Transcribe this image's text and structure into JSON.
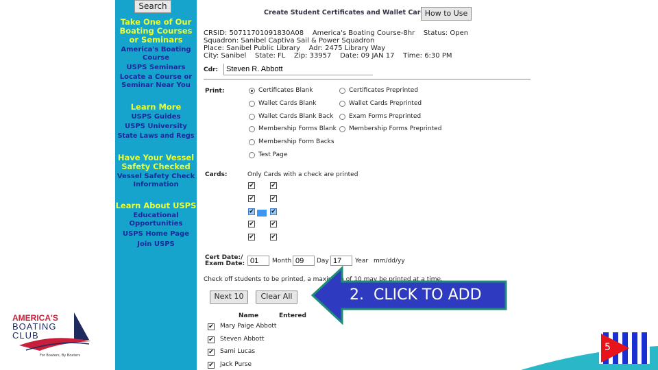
{
  "sidebar": {
    "search_label": "Search",
    "sections": [
      {
        "heading": "Take One of Our Boating Courses or Seminars",
        "links": [
          "America's Boating Course",
          "USPS Seminars",
          "Locate a Course or Seminar Near You"
        ]
      },
      {
        "heading": "Learn More",
        "links": [
          "USPS Guides",
          "USPS University",
          "State Laws and Regs"
        ]
      },
      {
        "heading": "Have Your Vessel Safety Checked",
        "links": [
          "Vessel Safety Check Information"
        ]
      },
      {
        "heading": "Learn About USPS",
        "links": [
          "Educational Opportunities",
          "USPS Home Page",
          "Join USPS"
        ]
      }
    ]
  },
  "header": {
    "title": "Create Student Certificates and Wallet Cards",
    "how_to_use": "How to Use"
  },
  "course": {
    "line1": "CRSID: 50711701091830A08    America's Boating Course-8hr    Status: Open",
    "line2": "Squadron: Sanibel Captiva Sail & Power Squadron",
    "line3": "Place: Sanibel Public Library    Adr: 2475 Library Way",
    "line4": "City: Sanibel    State: FL    Zip: 33957    Date: 09 JAN 17    Time: 6:30 PM"
  },
  "cdr": {
    "label": "Cdr:",
    "value": "Steven R. Abbott"
  },
  "print": {
    "label": "Print:",
    "options": [
      "Certificates Blank",
      "Wallet Cards Blank",
      "Wallet Cards Blank Back",
      "Membership Forms Blank",
      "Membership Form Backs",
      "Test Page",
      "Certificates Preprinted",
      "Wallet Cards Preprinted",
      "Exam Forms Preprinted",
      "Membership Forms Preprinted"
    ],
    "selected": "Certificates Blank"
  },
  "cards": {
    "label": "Cards:",
    "note": "Only Cards with a check are printed"
  },
  "dates": {
    "label1": "Cert Date:/",
    "label2": "Exam Date:",
    "month": "01",
    "month_label": "Month",
    "day": "09",
    "day_label": "Day",
    "year": "17",
    "year_label": "Year",
    "format": "mm/dd/yy"
  },
  "students": {
    "instruction": "Check off students to be printed, a maximum of 10 may be printed at a time.",
    "next_label": "Next 10",
    "clear_label": "Clear All",
    "col_name": "Name",
    "col_entered": "Entered",
    "rows": [
      "Mary Paige Abbott",
      "Steven Abbott",
      "Sami Lucas",
      "Jack Purse"
    ]
  },
  "callout": {
    "text": "2.  CLICK TO ADD",
    "fill": "#2e3bc1",
    "border": "#1f8c7a"
  },
  "logo": {
    "line1": "AMERICA'S",
    "line2": "BOATING",
    "line3": "CLUB",
    "tagline": "For Boaters, By Boaters"
  },
  "flag": {
    "number": "5"
  }
}
